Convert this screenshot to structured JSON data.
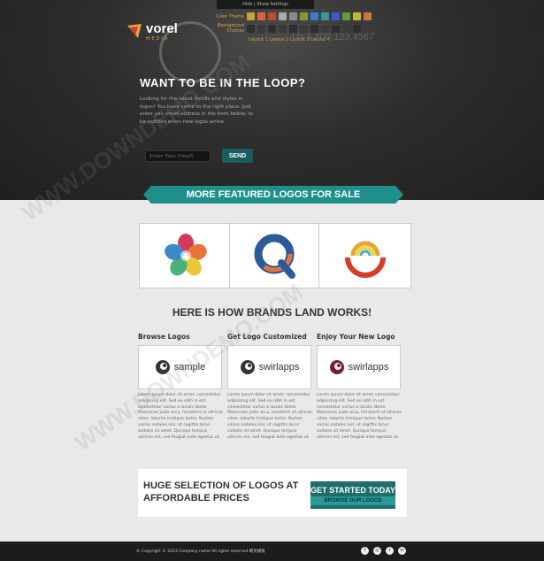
{
  "header": {
    "settings_toggle": "Hide | Show Settings",
    "brand_name": "vorel",
    "brand_sub": "MEDIA",
    "color_theme_label": "Color Theme",
    "background_choices_label": "Background Choices",
    "theme_colors": [
      "#c9a13a",
      "#d46a3a",
      "#c9443a",
      "#aaaaaa",
      "#8a8a8a",
      "#7aa03a",
      "#3a7ac9",
      "#3a9a9a",
      "#3a5ac9",
      "#6a9a3a",
      "#c9b43a",
      "#c97a3a"
    ],
    "layouts_label": "Layout 1  Layout 2  Layout 3  Layout 4",
    "phone": "Us 1.800.123.4567"
  },
  "newsletter": {
    "title": "WANT TO BE IN THE LOOP?",
    "text": "Looking for the latest trends and styles in logos? You have come to the right place. Just enter you email address in the form below, to be notified when new logos arrive.",
    "email_placeholder": "Enter Your Email!",
    "send_label": "SEND"
  },
  "featured": {
    "title": "MORE FEATURED LOGOS FOR SALE",
    "logos": [
      "flower-logo-icon",
      "q-logo-icon",
      "rainbow-arc-logo-icon"
    ]
  },
  "how": {
    "title": "HERE IS HOW BRANDS LAND WORKS!",
    "steps": [
      {
        "title": "Browse Logos",
        "brand": "sample",
        "text": "Lorem ipsum dolor sit amet, consectetur adipiscing elit. Sed eu nibh in est consectetur varius a iaculis libero. Maecenas justo arcu, hendrerit ut ultrices vitae, lobortis tristique tortor. Nullam varius sodales nisi, ut sagittis lacus sodales sit amet. Quisque tempus ultrices est, sed feugiat ante egestas ut."
      },
      {
        "title": "Get Logo Customized",
        "brand": "swirlapps",
        "text": "Lorem ipsum dolor sit amet, consectetur adipiscing elit. Sed eu nibh in est consectetur varius a iaculis libero. Maecenas justo arcu, hendrerit ut ultrices vitae, lobortis tristique tortor. Nullam varius sodales nisi, ut sagittis lacus sodales sit amet. Quisque tempus ultrices est, sed feugiat ante egestas ut."
      },
      {
        "title": "Enjoy Your New Logo",
        "brand": "swirlapps",
        "text": "Lorem ipsum dolor sit amet, consectetur adipiscing elit. Sed eu nibh in est consectetur varius a iaculis libero. Maecenas justo arcu, hendrerit ut ultrices vitae, lobortis tristique tortor. Nullam varius sodales nisi, ut sagittis lacus sodales sit amet. Quisque tempus ultrices est, sed feugiat ante egestas ut."
      }
    ]
  },
  "cta": {
    "line1": "HUGE SELECTION OF LOGOS AT",
    "line2": "AFFORDABLE PRICES",
    "button_line1": "GET STARTED TODAY",
    "button_line2": "BROWSE OUR LOGOS"
  },
  "footer": {
    "copyright": "© Copyright © 2013 Company name All rights reserved.网页模板",
    "social": [
      {
        "icon": "facebook-icon",
        "glyph": "f"
      },
      {
        "icon": "dribbble-icon",
        "glyph": "◎"
      },
      {
        "icon": "twitter-icon",
        "glyph": "t"
      },
      {
        "icon": "linkedin-icon",
        "glyph": "in"
      }
    ]
  },
  "watermark": "WWW.DOWNDEMO.COM"
}
